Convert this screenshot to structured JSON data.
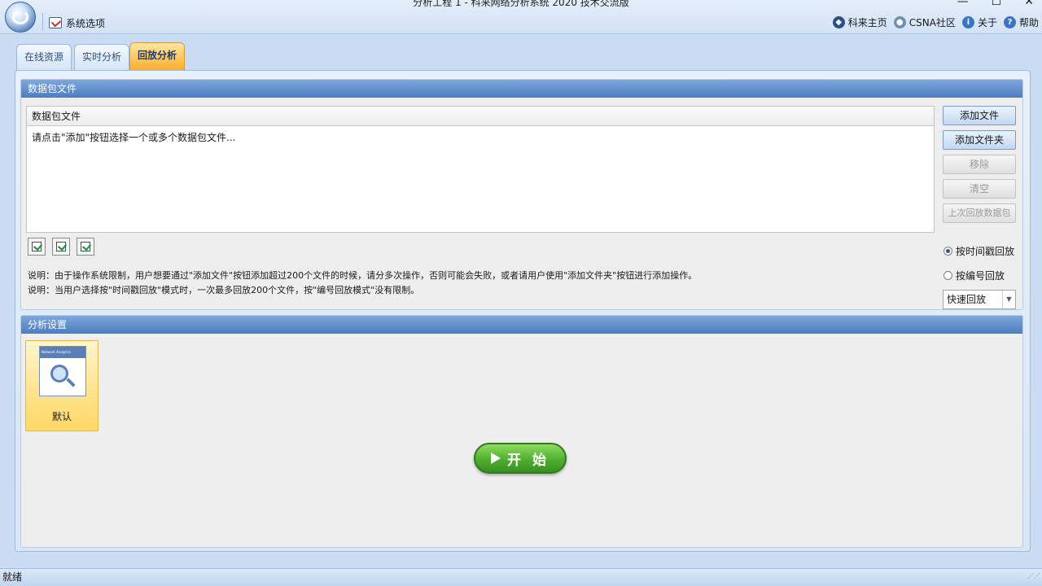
{
  "window": {
    "title": "分析工程 1 - 科来网络分析系统 2020 技术交流版",
    "controls": [
      "—",
      "☐",
      "✕"
    ]
  },
  "quick_access": {
    "system_options": "系统选项"
  },
  "top_links": {
    "home": "科来主页",
    "community": "CSNA社区",
    "about": "关于",
    "help": "帮助"
  },
  "tabs": [
    "在线资源",
    "实时分析",
    "回放分析"
  ],
  "packet_section": {
    "header": "数据包文件",
    "column_header": "数据包文件",
    "hint": "请点击\"添加\"按钮选择一个或多个数据包文件...",
    "buttons": {
      "add_file": "添加文件",
      "add_folder": "添加文件夹",
      "remove": "移除",
      "clear": "清空",
      "last_replay": "上次回放数据包"
    },
    "notes": [
      "说明：由于操作系统限制，用户想要通过\"添加文件\"按钮添加超过200个文件的时候，请分多次操作，否则可能会失败，或者请用户使用\"添加文件夹\"按钮进行添加操作。",
      "说明：当用户选择按\"时间戳回放\"模式时，一次最多回放200个文件，按\"编号回放模式\"没有限制。"
    ],
    "radio_timestamp": "按时间戳回放",
    "radio_number": "按编号回放",
    "speed_value": "快速回放"
  },
  "analysis_section": {
    "header": "分析设置",
    "profile_label": "默认",
    "profile_thumb_title": "Network Analytics",
    "start_label": "开 始"
  },
  "status": {
    "text": "就绪"
  }
}
